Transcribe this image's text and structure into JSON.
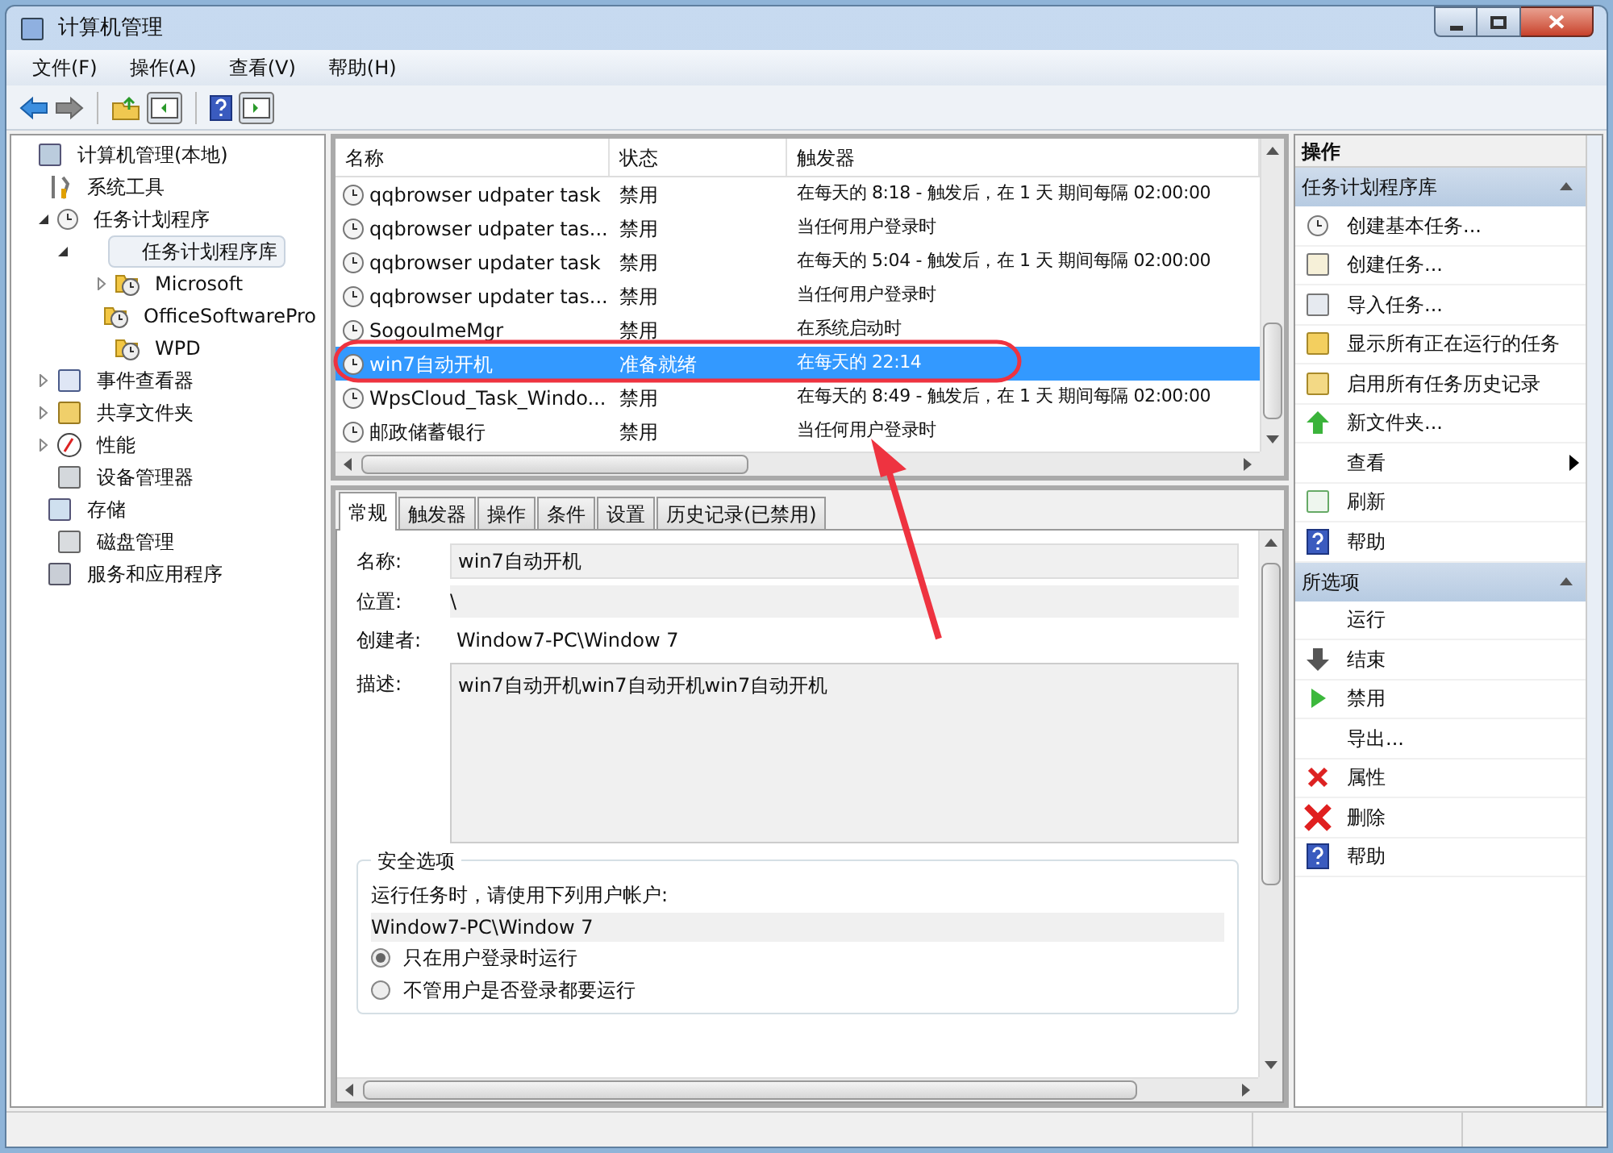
{
  "window": {
    "title": "计算机管理"
  },
  "menu": [
    "文件(F)",
    "操作(A)",
    "查看(V)",
    "帮助(H)"
  ],
  "tree": [
    {
      "label": "计算机管理(本地)",
      "selected": false,
      "children": [
        {
          "label": "系统工具",
          "selected": false,
          "children": [
            {
              "label": "任务计划程序",
              "selected": false,
              "expanded": true,
              "children": [
                {
                  "label": "任务计划程序库",
                  "selected": true,
                  "expanded": true,
                  "children": [
                    {
                      "label": "Microsoft",
                      "selected": false,
                      "expanded": false
                    },
                    {
                      "label": "OfficeSoftwarePro",
                      "selected": false
                    },
                    {
                      "label": "WPD",
                      "selected": false
                    }
                  ]
                }
              ]
            },
            {
              "label": "事件查看器",
              "selected": false,
              "expanded": false
            },
            {
              "label": "共享文件夹",
              "selected": false,
              "expanded": false
            },
            {
              "label": "性能",
              "selected": false,
              "expanded": false
            },
            {
              "label": "设备管理器",
              "selected": false
            }
          ]
        },
        {
          "label": "存储",
          "selected": false,
          "children": [
            {
              "label": "磁盘管理",
              "selected": false
            }
          ]
        },
        {
          "label": "服务和应用程序",
          "selected": false
        }
      ]
    }
  ],
  "tasks": {
    "columns": [
      "名称",
      "状态",
      "触发器"
    ],
    "rows": [
      {
        "name": "qqbrowser udpater task",
        "status": "禁用",
        "trigger": "在每天的 8:18 - 触发后，在 1 天 期间每隔 02:00:00",
        "selected": false
      },
      {
        "name": "qqbrowser udpater tas...",
        "status": "禁用",
        "trigger": "当任何用户登录时",
        "selected": false
      },
      {
        "name": "qqbrowser updater task",
        "status": "禁用",
        "trigger": "在每天的 5:04 - 触发后，在 1 天 期间每隔 02:00:00",
        "selected": false
      },
      {
        "name": "qqbrowser updater tas...",
        "status": "禁用",
        "trigger": "当任何用户登录时",
        "selected": false
      },
      {
        "name": "SogouImeMgr",
        "status": "禁用",
        "trigger": "在系统启动时",
        "selected": false
      },
      {
        "name": "win7自动开机",
        "status": "准备就绪",
        "trigger": "在每天的 22:14",
        "selected": true
      },
      {
        "name": "WpsCloud_Task_Windo...",
        "status": "禁用",
        "trigger": "在每天的 8:49 - 触发后，在 1 天 期间每隔 02:00:00",
        "selected": false
      },
      {
        "name": "邮政储蓄银行",
        "status": "禁用",
        "trigger": "当任何用户登录时",
        "selected": false
      }
    ]
  },
  "tabs": [
    {
      "label": "常规",
      "selected": true
    },
    {
      "label": "触发器",
      "selected": false
    },
    {
      "label": "操作",
      "selected": false
    },
    {
      "label": "条件",
      "selected": false
    },
    {
      "label": "设置",
      "selected": false
    },
    {
      "label": "历史记录(已禁用)",
      "selected": false
    }
  ],
  "general": {
    "name_label": "名称:",
    "name": "win7自动开机",
    "location_label": "位置:",
    "location": "\\",
    "author_label": "创建者:",
    "author": "Window7-PC\\Window 7",
    "description_label": "描述:",
    "description": "win7自动开机win7自动开机win7自动开机"
  },
  "security": {
    "title": "安全选项",
    "prompt": "运行任务时，请使用下列用户帐户:",
    "account": "Window7-PC\\Window 7",
    "options": [
      {
        "label": "只在用户登录时运行",
        "selected": true
      },
      {
        "label": "不管用户是否登录都要运行",
        "selected": false
      }
    ]
  },
  "actions": {
    "title": "操作",
    "sections": [
      {
        "title": "任务计划程序库",
        "expanded": true,
        "items": [
          {
            "label": "创建基本任务...",
            "kind": "command"
          },
          {
            "label": "创建任务...",
            "kind": "command"
          },
          {
            "label": "导入任务...",
            "kind": "command"
          },
          {
            "label": "显示所有正在运行的任务",
            "kind": "command"
          },
          {
            "label": "启用所有任务历史记录",
            "kind": "command"
          },
          {
            "label": "新文件夹...",
            "kind": "command"
          },
          {
            "label": "查看",
            "kind": "submenu"
          },
          {
            "label": "刷新",
            "kind": "command"
          },
          {
            "label": "帮助",
            "kind": "command"
          }
        ]
      },
      {
        "title": "所选项",
        "expanded": true,
        "items": [
          {
            "label": "运行",
            "kind": "command"
          },
          {
            "label": "结束",
            "kind": "command"
          },
          {
            "label": "禁用",
            "kind": "command"
          },
          {
            "label": "导出...",
            "kind": "command"
          },
          {
            "label": "属性",
            "kind": "command"
          },
          {
            "label": "删除",
            "kind": "command"
          },
          {
            "label": "帮助",
            "kind": "command"
          }
        ]
      }
    ]
  },
  "annotation": {
    "kind": "ellipse_with_arrow"
  }
}
